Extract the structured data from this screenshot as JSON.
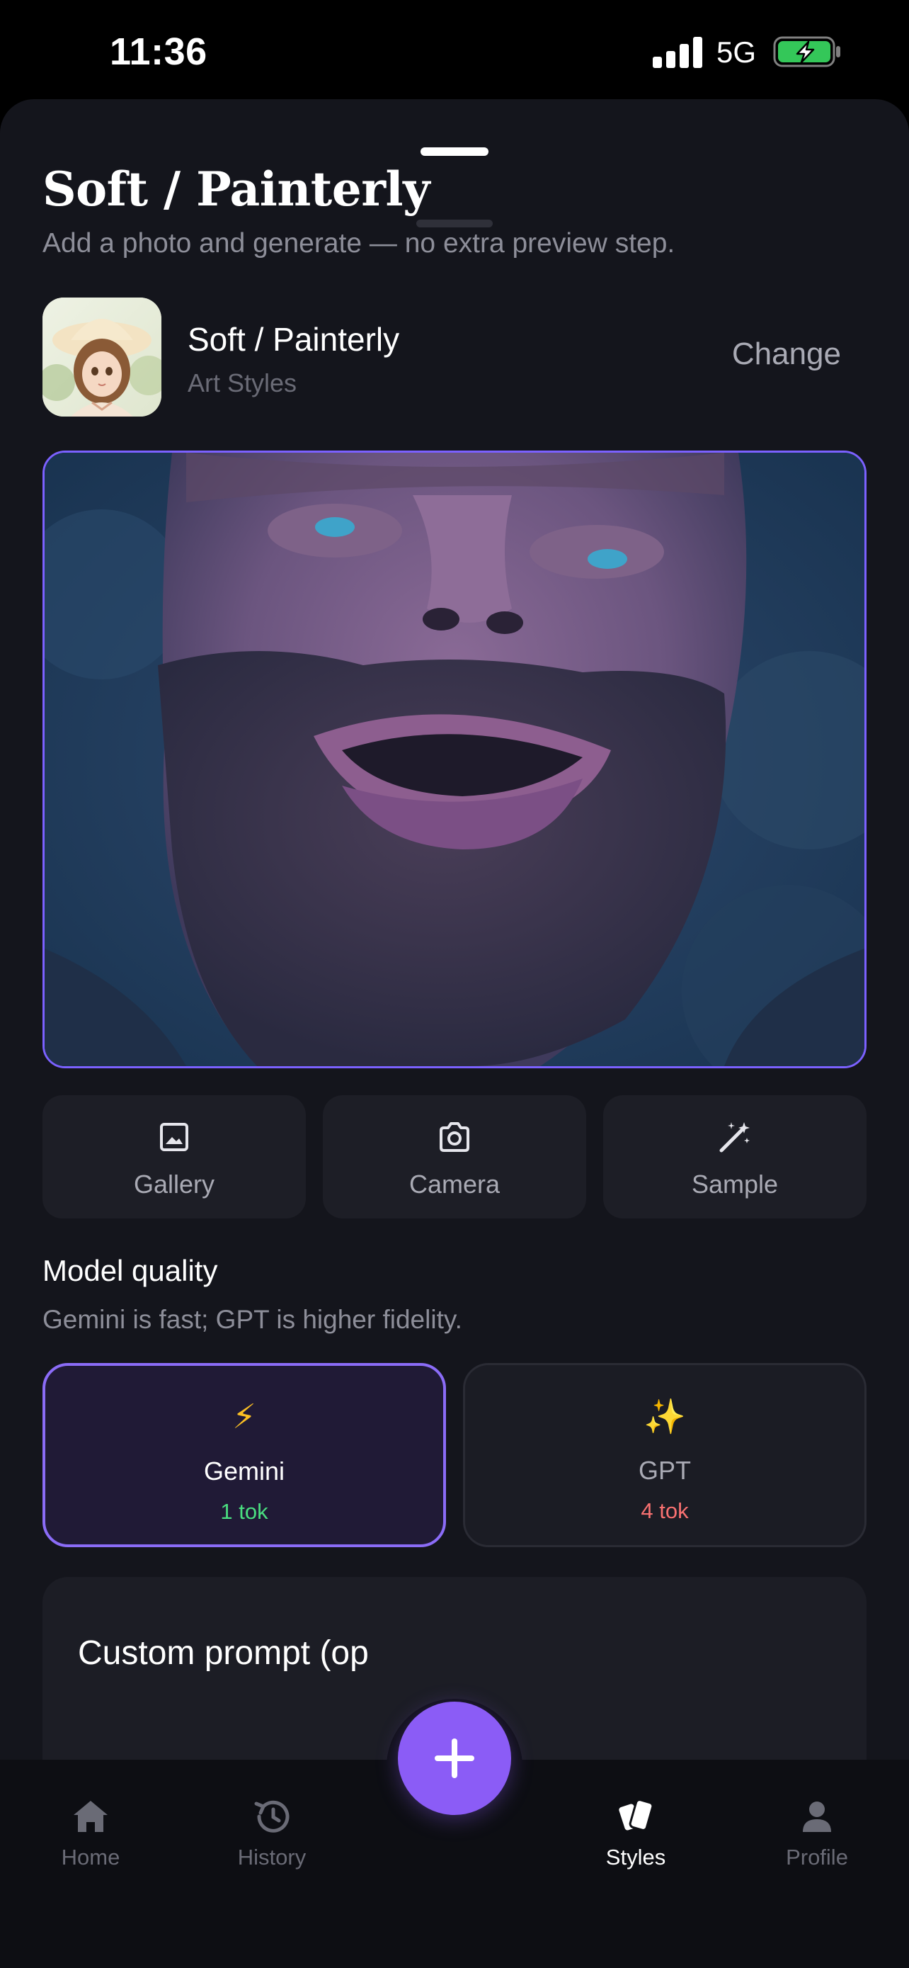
{
  "status_bar": {
    "time": "11:36",
    "network": "5G",
    "battery_charging": true
  },
  "header": {
    "title": "Soft / Painterly",
    "subtitle": "Add a photo and generate — no extra preview step."
  },
  "selected_style": {
    "name": "Soft / Painterly",
    "category": "Art Styles",
    "change_label": "Change"
  },
  "source_actions": [
    {
      "label": "Gallery",
      "icon": "image-icon"
    },
    {
      "label": "Camera",
      "icon": "camera-icon"
    },
    {
      "label": "Sample",
      "icon": "magic-wand-icon"
    }
  ],
  "model_quality": {
    "title": "Model quality",
    "subtitle": "Gemini is fast; GPT is higher fidelity.",
    "options": [
      {
        "emoji": "⚡",
        "name": "Gemini",
        "cost": "1 tok",
        "selected": true,
        "cost_color": "#4ade80"
      },
      {
        "emoji": "✨",
        "name": "GPT",
        "cost": "4 tok",
        "selected": false,
        "cost_color": "#f87171"
      }
    ]
  },
  "custom_prompt": {
    "label": "Custom prompt (op"
  },
  "tab_bar": {
    "tabs": [
      {
        "label": "Home",
        "icon": "home-icon",
        "active": false
      },
      {
        "label": "History",
        "icon": "history-icon",
        "active": false
      },
      {
        "label": "Styles",
        "icon": "cards-icon",
        "active": true
      },
      {
        "label": "Profile",
        "icon": "person-icon",
        "active": false
      }
    ],
    "fab_icon": "plus-icon"
  },
  "colors": {
    "accent": "#8b5cf6",
    "background": "#14151c",
    "positive": "#4ade80",
    "negative": "#f87171"
  }
}
